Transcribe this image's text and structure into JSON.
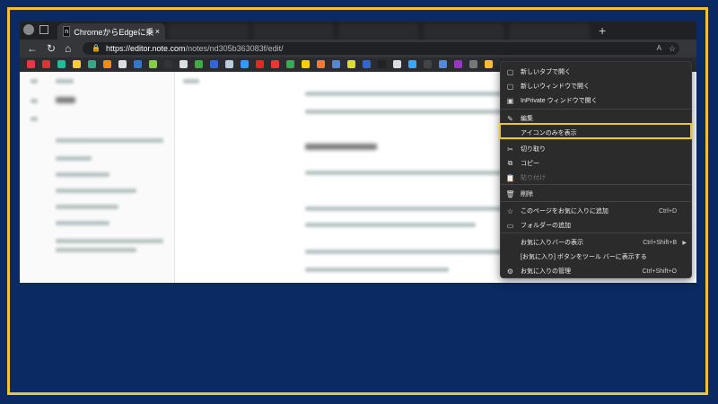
{
  "colors": {
    "background": "#0b2a63",
    "frame": "#f2c230",
    "menu_bg": "#2b2b2b"
  },
  "browser": {
    "active_tab_title": "ChromeからEdgeに乗り換えたうえ",
    "active_tab_favicon": "n",
    "close_label": "×",
    "new_tab_label": "+",
    "url_host": "https://editor.note.com",
    "url_path": "/notes/nd305b363083f/edit/",
    "reader_label": "A",
    "favorites": [
      "#e34",
      "#d33",
      "#2b9",
      "#fc3",
      "#3a8",
      "#f80",
      "#ddd",
      "#37c",
      "#8c4",
      "#333",
      "#ddd",
      "#4a4",
      "#36d",
      "#bcd",
      "#39f",
      "#e22",
      "#e33",
      "#3a5",
      "#fc0",
      "#f73",
      "#58c",
      "#dd2",
      "#36c",
      "#222",
      "#ddd",
      "#3af",
      "#444",
      "#58d",
      "#93c",
      "#777",
      "#fb3"
    ]
  },
  "menu": {
    "items": [
      {
        "label": "新しいタブで開く",
        "icon": "new-tab-icon",
        "glyph": "▢"
      },
      {
        "label": "新しいウィンドウで開く",
        "icon": "new-window-icon",
        "glyph": "▢"
      },
      {
        "label": "InPrivate ウィンドウで開く",
        "icon": "inprivate-icon",
        "glyph": "▣"
      },
      {
        "label": "編集",
        "icon": "edit-pencil-icon",
        "glyph": "✎"
      },
      {
        "label": "アイコンのみを表示",
        "icon": "",
        "glyph": ""
      },
      {
        "label": "切り取り",
        "icon": "cut-scissors-icon",
        "glyph": "✂"
      },
      {
        "label": "コピー",
        "icon": "copy-icon",
        "glyph": "⧉"
      },
      {
        "label": "貼り付け",
        "icon": "paste-icon",
        "glyph": "📋"
      },
      {
        "label": "削除",
        "icon": "delete-trash-icon",
        "glyph": "🗑"
      },
      {
        "label": "このページをお気に入りに追加",
        "icon": "add-favorite-icon",
        "glyph": "☆",
        "shortcut": "Ctrl+D"
      },
      {
        "label": "フォルダーの追加",
        "icon": "add-folder-icon",
        "glyph": "▭"
      },
      {
        "label": "お気に入りバーの表示",
        "icon": "",
        "glyph": "",
        "shortcut": "Ctrl+Shift+B",
        "arrow": "▶"
      },
      {
        "label": "[お気に入り] ボタンをツール バーに表示する",
        "icon": "",
        "glyph": ""
      },
      {
        "label": "お気に入りの管理",
        "icon": "manage-favorites-icon",
        "glyph": "⚙",
        "shortcut": "Ctrl+Shift+O"
      }
    ]
  }
}
